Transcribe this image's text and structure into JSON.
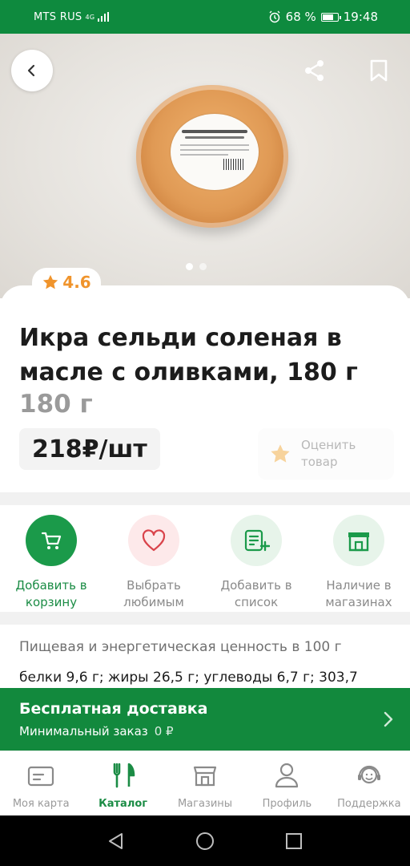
{
  "status_bar": {
    "carrier": "MTS RUS",
    "network": "4G",
    "battery": "68 %",
    "time": "19:48"
  },
  "hero": {
    "image_desc_icon": "product-jar-image",
    "carousel_pages": 2,
    "carousel_active": 1
  },
  "product": {
    "rating": "4.6",
    "title": "Икра сельди соленая в масле с оливками, 180 г",
    "weight": "180 г",
    "price": "218₽/шт",
    "rate_label": "Оценить товар"
  },
  "actions": [
    {
      "label": "Добавить в корзину",
      "icon": "cart-icon"
    },
    {
      "label": "Выбрать любимым",
      "icon": "heart-icon"
    },
    {
      "label": "Добавить в список",
      "icon": "list-add-icon"
    },
    {
      "label": "Наличие в магазинах",
      "icon": "store-icon"
    }
  ],
  "nutrition": {
    "title": "Пищевая и энергетическая ценность в 100 г",
    "values": "белки 9,6 г; жиры 26,5 г; углеводы 6,7 г; 303,7"
  },
  "delivery": {
    "title": "Бесплатная доставка",
    "min_order_label": "Минимальный заказ",
    "min_order_value": "0 ₽"
  },
  "tabs": [
    {
      "label": "Моя карта",
      "icon": "card-icon",
      "active": false
    },
    {
      "label": "Каталог",
      "icon": "fork-knife-icon",
      "active": true
    },
    {
      "label": "Магазины",
      "icon": "store-icon",
      "active": false
    },
    {
      "label": "Профиль",
      "icon": "profile-icon",
      "active": false
    },
    {
      "label": "Поддержка",
      "icon": "support-icon",
      "active": false
    }
  ],
  "colors": {
    "brand_green": "#0e8a3e",
    "rating_orange": "#f0942c",
    "action_green_bg": "#1b9a4a",
    "action_pink_bg": "#fde9ea",
    "action_mint_bg": "#e7f4ea"
  }
}
